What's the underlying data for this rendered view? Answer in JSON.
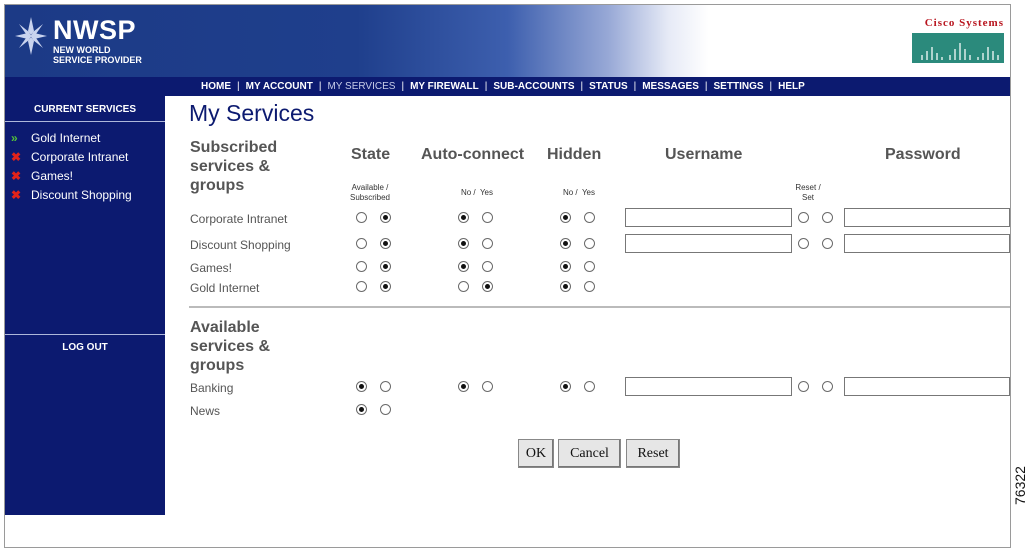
{
  "brand": {
    "name": "NWSP",
    "subtitle_line1": "NEW WORLD",
    "subtitle_line2": "SERVICE PROVIDER",
    "partner": "Cisco Systems"
  },
  "nav": {
    "items": [
      "HOME",
      "MY ACCOUNT",
      "MY SERVICES",
      "MY FIREWALL",
      "SUB-ACCOUNTS",
      "STATUS",
      "MESSAGES",
      "SETTINGS",
      "HELP"
    ],
    "active": "MY SERVICES"
  },
  "sidebar": {
    "title": "CURRENT SERVICES",
    "items": [
      {
        "label": "Gold Internet",
        "icon": "green-double-arrow-icon"
      },
      {
        "label": "Corporate Intranet",
        "icon": "red-x-icon"
      },
      {
        "label": "Games!",
        "icon": "red-x-icon"
      },
      {
        "label": "Discount Shopping",
        "icon": "red-x-icon"
      }
    ],
    "logout": "LOG OUT"
  },
  "page": {
    "title": "My Services"
  },
  "columns": {
    "state": "State",
    "autoconnect": "Auto-connect",
    "hidden": "Hidden",
    "username": "Username",
    "password": "Password",
    "state_sub": "Available / Subscribed",
    "yesno_sub": "No /  Yes",
    "reset_sub": "Reset / Set"
  },
  "subscribed": {
    "title": "Subscribed services & groups",
    "rows": [
      {
        "label": "Corporate Intranet",
        "state": "subscribed",
        "autoconnect": "no",
        "hidden": "no",
        "has_credentials": true,
        "reset": "none",
        "username": "",
        "password": ""
      },
      {
        "label": "Discount Shopping",
        "state": "subscribed",
        "autoconnect": "no",
        "hidden": "no",
        "has_credentials": true,
        "reset": "none",
        "username": "",
        "password": ""
      },
      {
        "label": "Games!",
        "state": "subscribed",
        "autoconnect": "no",
        "hidden": "no",
        "has_credentials": false
      },
      {
        "label": "Gold Internet",
        "state": "subscribed",
        "autoconnect": "yes",
        "hidden": "no",
        "has_credentials": false
      }
    ]
  },
  "available": {
    "title": "Available services & groups",
    "rows": [
      {
        "label": "Banking",
        "state": "available",
        "autoconnect": "no",
        "hidden": "no",
        "has_credentials": true,
        "reset": "none",
        "username": "",
        "password": ""
      },
      {
        "label": "News",
        "state": "available",
        "autoconnect": null,
        "hidden": null,
        "has_credentials": false
      }
    ]
  },
  "buttons": {
    "ok": "OK",
    "cancel": "Cancel",
    "reset": "Reset"
  },
  "figure_number": "76322",
  "colors": {
    "nav": "#0c1a70",
    "title": "#0c1a70",
    "cisco_red": "#b8141e"
  }
}
